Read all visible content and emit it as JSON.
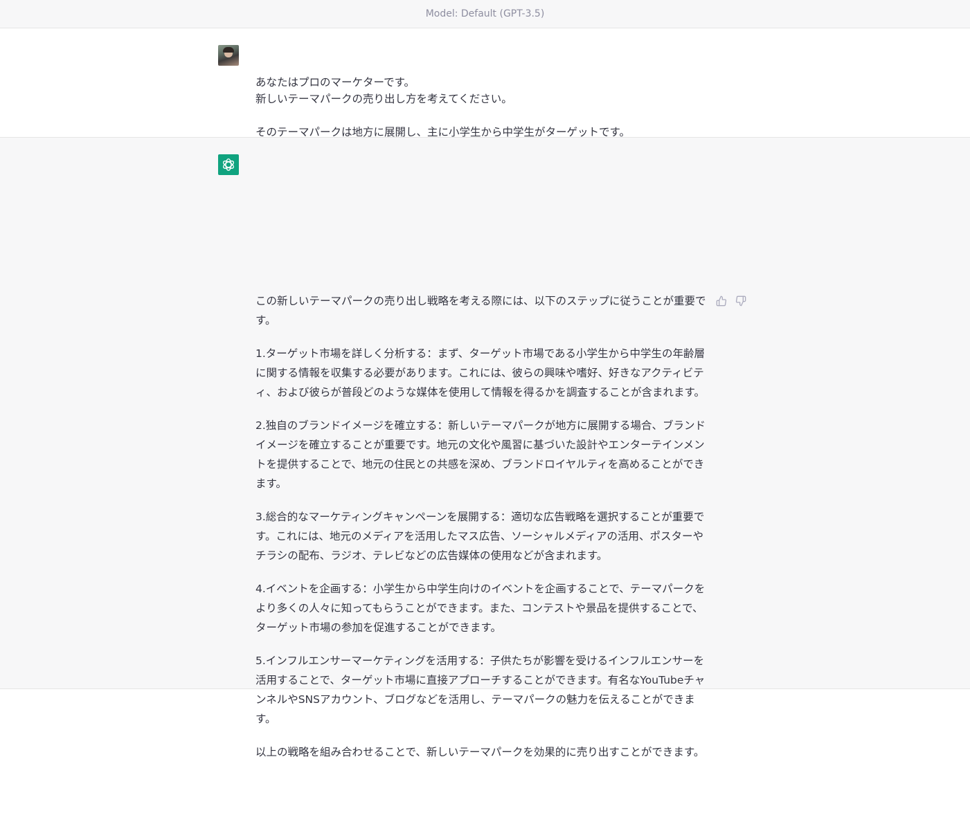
{
  "header": {
    "model_label": "Model: Default (GPT-3.5)"
  },
  "user_message": {
    "lines": [
      "あなたはプロのマーケターです。",
      "新しいテーマパークの売り出し方を考えてください。",
      "そのテーマパークは地方に展開し、主に小学生から中学生がターゲットです。"
    ]
  },
  "assistant_message": {
    "paragraphs": [
      "この新しいテーマパークの売り出し戦略を考える際には、以下のステップに従うことが重要です。",
      "1.ターゲット市場を詳しく分析する：まず、ターゲット市場である小学生から中学生の年齢層に関する情報を収集する必要があります。これには、彼らの興味や嗜好、好きなアクティビティ、および彼らが普段どのような媒体を使用して情報を得るかを調査することが含まれます。",
      "2.独自のブランドイメージを確立する：新しいテーマパークが地方に展開する場合、ブランドイメージを確立することが重要です。地元の文化や風習に基づいた設計やエンターテインメントを提供することで、地元の住民との共感を深め、ブランドロイヤルティを高めることができます。",
      "3.総合的なマーケティングキャンペーンを展開する：適切な広告戦略を選択することが重要です。これには、地元のメディアを活用したマス広告、ソーシャルメディアの活用、ポスターやチラシの配布、ラジオ、テレビなどの広告媒体の使用などが含まれます。",
      "4.イベントを企画する：小学生から中学生向けのイベントを企画することで、テーマパークをより多くの人々に知ってもらうことができます。また、コンテストや景品を提供することで、ターゲット市場の参加を促進することができます。",
      "5.インフルエンサーマーケティングを活用する：子供たちが影響を受けるインフルエンサーを活用することで、ターゲット市場に直接アプローチすることができます。有名なYouTubeチャンネルやSNSアカウント、ブログなどを活用し、テーマパークの魅力を伝えることができます。",
      "以上の戦略を組み合わせることで、新しいテーマパークを効果的に売り出すことができます。"
    ]
  },
  "icons": {
    "user_avatar": "user-avatar-photo",
    "assistant_avatar": "openai-logo-icon",
    "thumbs_up": "thumbs-up-icon",
    "thumbs_down": "thumbs-down-icon"
  },
  "colors": {
    "assistant_avatar_bg": "#10a37f",
    "assistant_row_bg": "#f7f7f8",
    "text": "#343541",
    "muted": "#8e8ea0"
  }
}
